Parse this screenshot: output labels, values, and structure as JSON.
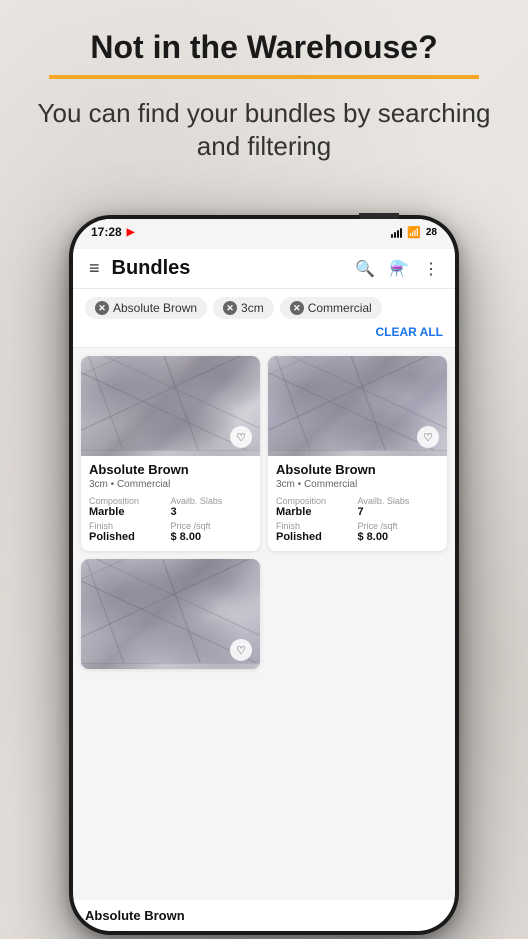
{
  "header": {
    "title": "Not in the Warehouse?",
    "subtitle": "You can find your bundles by searching and filtering"
  },
  "statusBar": {
    "time": "17:28",
    "battery": "28"
  },
  "appBar": {
    "title": "Bundles"
  },
  "filters": {
    "chips": [
      "Absolute Brown",
      "3cm",
      "Commercial"
    ],
    "clearAll": "CLEAR ALL"
  },
  "cards": [
    {
      "title": "Absolute Brown",
      "subtitle": "3cm • Commercial",
      "composition": "Marble",
      "slabs": "3",
      "finish": "Polished",
      "price": "$ 8.00"
    },
    {
      "title": "Absolute Brown",
      "subtitle": "3cm • Commercial",
      "composition": "Marble",
      "slabs": "7",
      "finish": "Polished",
      "price": "$ 8.00"
    },
    {
      "title": "Absolute Brown",
      "subtitle": "",
      "composition": "",
      "slabs": "",
      "finish": "",
      "price": ""
    }
  ],
  "labels": {
    "composition": "Composition",
    "availableSlabs": "Availb. Slabs",
    "finish": "Finish",
    "price": "Price /sqft"
  },
  "bottomLabel": "Absolute Brown"
}
